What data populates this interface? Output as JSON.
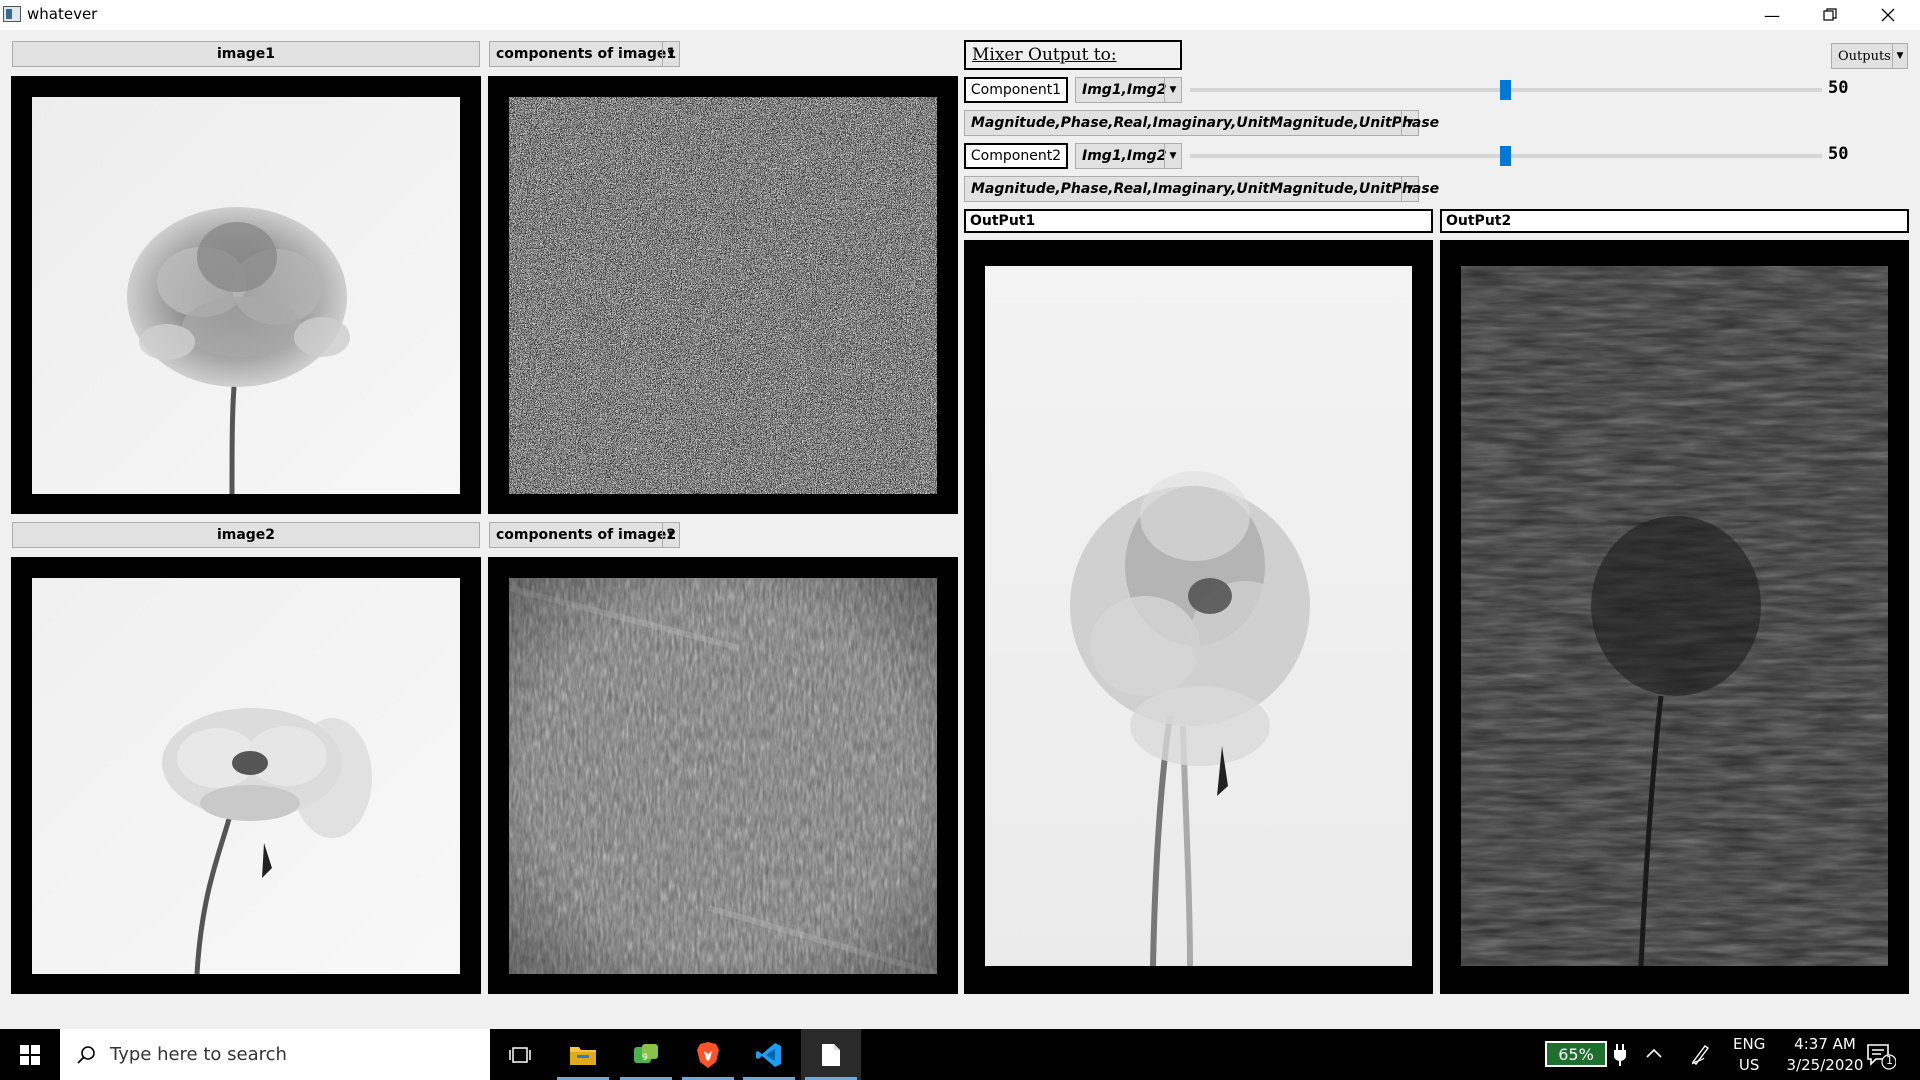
{
  "window": {
    "title": "whatever"
  },
  "left": {
    "image1_button": "image1",
    "image1_combo": "components of image1",
    "image2_button": "image2",
    "image2_combo": "components of image2"
  },
  "mixer": {
    "title": "Mixer Output to:",
    "outputs_combo": "Outputs",
    "component1": {
      "label": "Component1",
      "images": "Img1,Img2",
      "value": "50",
      "level": 0.5,
      "types": "Magnitude,Phase,Real,Imaginary,UnitMagnitude,UnitPhase"
    },
    "component2": {
      "label": "Component2",
      "images": "Img1,Img2",
      "value": "50",
      "level": 0.5,
      "types": "Magnitude,Phase,Real,Imaginary,UnitMagnitude,UnitPhase"
    },
    "output1_label": "OutPut1",
    "output2_label": "OutPut2"
  },
  "taskbar": {
    "search_placeholder": "Type here to search",
    "battery": "65%",
    "lang_top": "ENG",
    "lang_bottom": "US",
    "time": "4:37 AM",
    "date": "3/25/2020",
    "notif_count": "1"
  }
}
